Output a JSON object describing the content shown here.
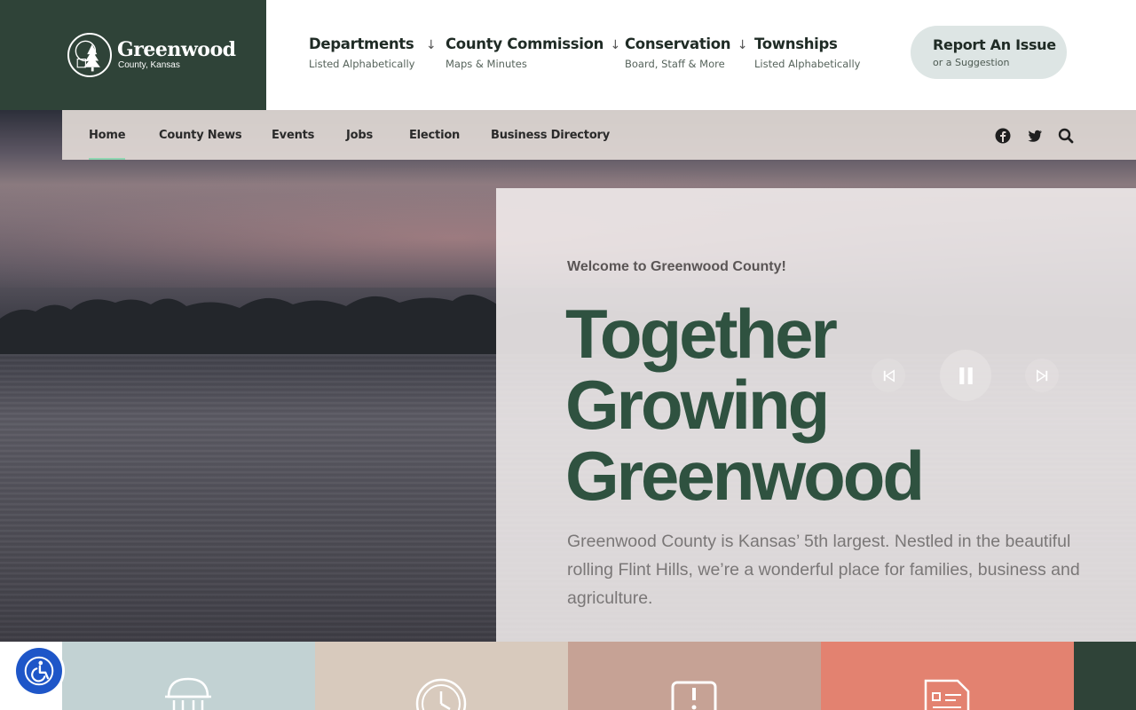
{
  "logo": {
    "name": "Greenwood",
    "subtitle": "County, Kansas",
    "bg_color": "#2f4338"
  },
  "topnav": [
    {
      "title": "Departments",
      "arrow": "↓",
      "sub": "Listed Alphabetically"
    },
    {
      "title": "County Commission",
      "arrow": "↓",
      "sub": "Maps & Minutes"
    },
    {
      "title": "Conservation",
      "arrow": "↓",
      "sub": "Board, Staff & More"
    },
    {
      "title": "Townships",
      "arrow": "",
      "sub": "Listed Alphabetically"
    }
  ],
  "report": {
    "title": "Report An Issue",
    "sub": "or a Suggestion"
  },
  "subnav": {
    "items": [
      "Home",
      "County News",
      "Events",
      "Jobs",
      "Election",
      "Business Directory"
    ],
    "active": "Home",
    "social_icons": [
      "facebook-icon",
      "twitter-icon",
      "search-icon"
    ]
  },
  "hero": {
    "welcome": "Welcome to Greenwood County!",
    "headline_lines": [
      "Together",
      "Growing",
      "Greenwood"
    ],
    "description": "Greenwood County is Kansas’ 5th largest. Nestled in the beautiful rolling Flint Hills, we’re a wonderful place for families, business and agriculture.",
    "headline_color": "#2f5240",
    "controls": [
      "previous-icon",
      "pause-icon",
      "next-icon"
    ]
  },
  "tiles": [
    {
      "icon": "courthouse-icon",
      "color": "#c2d2d3"
    },
    {
      "icon": "clock-icon",
      "color": "#d8cabd"
    },
    {
      "icon": "alert-icon",
      "color": "#c6a295"
    },
    {
      "icon": "form-icon",
      "color": "#e38270"
    },
    {
      "icon": "",
      "color": "#2f4338"
    }
  ],
  "accessibility": {
    "icon": "accessibility-icon",
    "color": "#1e56c8"
  }
}
